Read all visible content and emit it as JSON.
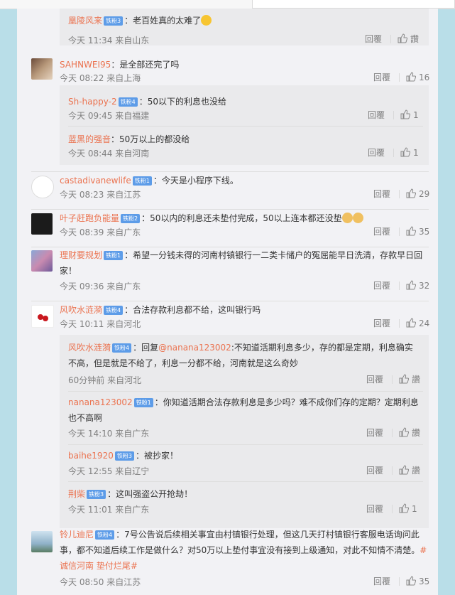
{
  "comments": [
    {
      "name": "凰陵风来",
      "badge": "铁粉3",
      "text": "：老百姓真的太难了",
      "time": "今天 11:34 来自山东",
      "reply": "回覆",
      "likes": "讚"
    },
    {
      "name": "SAHNWEI95",
      "text": "：是全部还完了吗",
      "time": "今天 08:22 来自上海",
      "reply": "回覆",
      "likes": "16"
    },
    {
      "name": "Sh-happy-2",
      "badge": "铁粉4",
      "text": "：50以下的利息也没给",
      "time": "今天 09:45 来自福建",
      "reply": "回覆",
      "likes": "1"
    },
    {
      "name": "蓝黑的强音",
      "text": "：50万以上的都没给",
      "time": "今天 08:44 来自河南",
      "reply": "回覆",
      "likes": "1"
    },
    {
      "name": "castadivanewlife",
      "badge": "铁粉1",
      "text": "：今天是小程序下线。",
      "time": "今天 08:23 来自江苏",
      "reply": "回覆",
      "likes": "29"
    },
    {
      "name": "叶子赶跑负能量",
      "badge": "铁粉2",
      "text": "：50以内的利息还未垫付完成，50以上连本都还没垫",
      "time": "今天 08:39 来自广东",
      "reply": "回覆",
      "likes": "35"
    },
    {
      "name": "理财要规划",
      "badge": "铁粉1",
      "text": "：希望一分钱未得的河南村镇银行一二类卡储户的冤屈能早日洗清，存款早日回",
      "text2": "家！",
      "time": "今天 09:36 来自广东",
      "reply": "回覆",
      "likes": "32"
    },
    {
      "name": "风吹水涟漪",
      "badge": "铁粉4",
      "text": "：合法存款利息都不给，这叫银行吗",
      "time": "今天 10:11 来自河北",
      "reply": "回覆",
      "likes": "24"
    },
    {
      "name": "风吹水涟漪",
      "badge": "铁粉4",
      "text": "：回复",
      "mention": "@nanana123002",
      "text_after": ":不知道活期利息多少，存的都是定期，利息确实",
      "text2": "不高，但是就是不给了，利息一分都不给，河南就是这么奇妙",
      "time": "60分钟前 来自河北",
      "reply": "回覆",
      "likes": "讚"
    },
    {
      "name": "nanana123002",
      "badge": "铁粉1",
      "text": "：你知道活期合法存款利息是多少吗？难不成你们存的定期？定期利息",
      "text2": "也不高啊",
      "time": "今天 14:10 来自广东",
      "reply": "回覆",
      "likes": "讚"
    },
    {
      "name": "baihe1920",
      "badge": "铁粉3",
      "text": "：被抄家！",
      "time": "今天 12:55 来自辽宁",
      "reply": "回覆",
      "likes": "讚"
    },
    {
      "name": "荆柴",
      "badge": "铁粉3",
      "text": "：这叫强盗公开抢劫！",
      "time": "今天 11:01 来自广东",
      "reply": "回覆",
      "likes": "1"
    },
    {
      "name": "铃儿迪尼",
      "badge": "铁粉4",
      "text": "：7号公告说后续相关事宜由村镇银行处理，但这几天打村镇银行客服电话询问此",
      "text2": "事，都不知道后续工作是做什么？对50万以上垫付事宜没有接到上级通知，对此不知情不清楚。",
      "topic": "#",
      "text3": "诚信河南 垫付烂尾#",
      "time": "今天 08:50 来自江苏",
      "reply": "回覆",
      "likes": "35"
    }
  ]
}
